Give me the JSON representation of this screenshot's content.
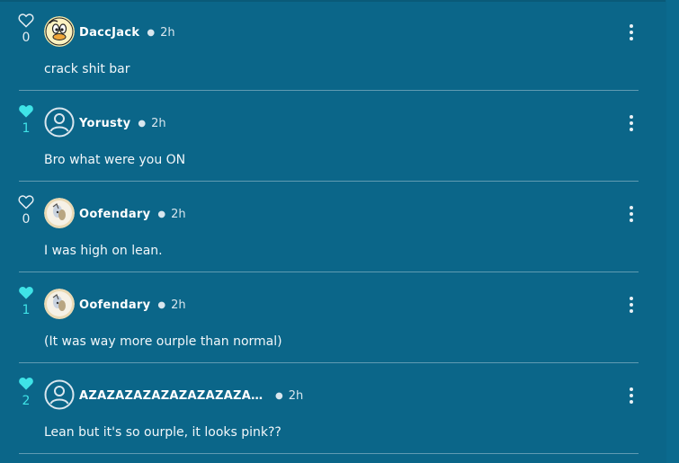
{
  "colors": {
    "background": "#0b6689",
    "like_active": "#3fe3e7",
    "text": "#ffffff"
  },
  "comments": [
    {
      "username": "DaccJack",
      "time": "2h",
      "text": "crack shit bar",
      "likes": "0",
      "liked": false,
      "avatar": "duck-avatar-icon"
    },
    {
      "username": "Yorusty",
      "time": "2h",
      "text": "Bro what were you ON",
      "likes": "1",
      "liked": true,
      "avatar": "default-user-icon"
    },
    {
      "username": "Oofendary",
      "time": "2h",
      "text": "I was high on lean.",
      "likes": "0",
      "liked": false,
      "avatar": "character-avatar-icon"
    },
    {
      "username": "Oofendary",
      "time": "2h",
      "text": "(It was way more ourple than normal)",
      "likes": "1",
      "liked": true,
      "avatar": "character-avatar-icon"
    },
    {
      "username": "AZAZAZAZAZAZAZAZAZAZA...",
      "time": "2h",
      "text": "Lean but it's so ourple, it looks pink??",
      "likes": "2",
      "liked": true,
      "avatar": "default-user-icon"
    }
  ]
}
